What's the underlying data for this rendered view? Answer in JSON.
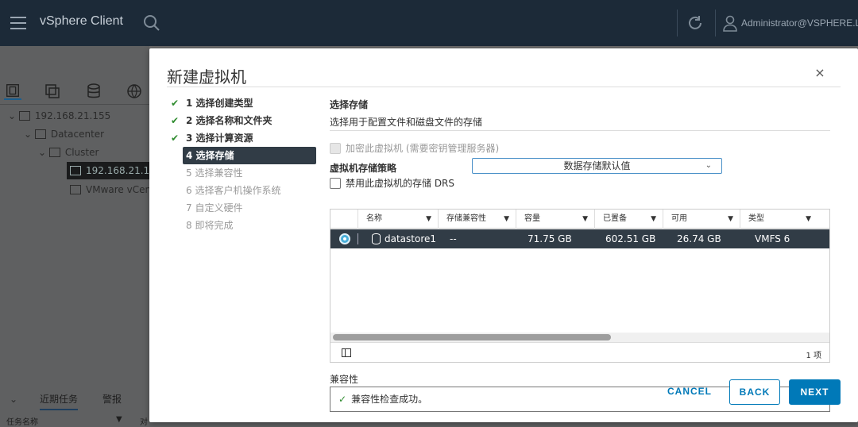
{
  "header": {
    "app_title": "vSphere Client",
    "user": "Administrator@VSPHERE.L"
  },
  "inventory": {
    "tree": [
      {
        "label": "192.168.21.155"
      },
      {
        "label": "Datacenter"
      },
      {
        "label": "Cluster"
      },
      {
        "label": "192.168.21.154",
        "selected": true
      },
      {
        "label": "VMware vCen"
      }
    ]
  },
  "bottom": {
    "tabs": [
      "近期任务",
      "警报"
    ],
    "col_task_name": "任务名称",
    "col_target": "对"
  },
  "modal": {
    "title": "新建虚拟机",
    "steps": [
      {
        "label": "1 选择创建类型",
        "state": "done"
      },
      {
        "label": "2 选择名称和文件夹",
        "state": "done"
      },
      {
        "label": "3 选择计算资源",
        "state": "done"
      },
      {
        "label": "4 选择存储",
        "state": "active"
      },
      {
        "label": "5 选择兼容性",
        "state": "todo"
      },
      {
        "label": "6 选择客户机操作系统",
        "state": "todo"
      },
      {
        "label": "7 自定义硬件",
        "state": "todo"
      },
      {
        "label": "8 即将完成",
        "state": "todo"
      }
    ],
    "section_title": "选择存储",
    "section_subtitle": "选择用于配置文件和磁盘文件的存储",
    "encrypt_label": "加密此虚拟机 (需要密钥管理服务器)",
    "policy_label": "虚拟机存储策略",
    "policy_value": "数据存储默认值",
    "drs_label": "禁用此虚拟机的存储 DRS",
    "grid": {
      "columns": [
        "名称",
        "存储兼容性",
        "容量",
        "已置备",
        "可用",
        "类型"
      ],
      "rows": [
        {
          "name": "datastore1",
          "compat": "--",
          "capacity": "71.75 GB",
          "provisioned": "602.51 GB",
          "free": "26.74 GB",
          "type": "VMFS 6"
        }
      ],
      "count": "1 项"
    },
    "compat_label": "兼容性",
    "compat_message": "兼容性检查成功。",
    "buttons": {
      "cancel": "CANCEL",
      "back": "BACK",
      "next": "NEXT"
    }
  }
}
